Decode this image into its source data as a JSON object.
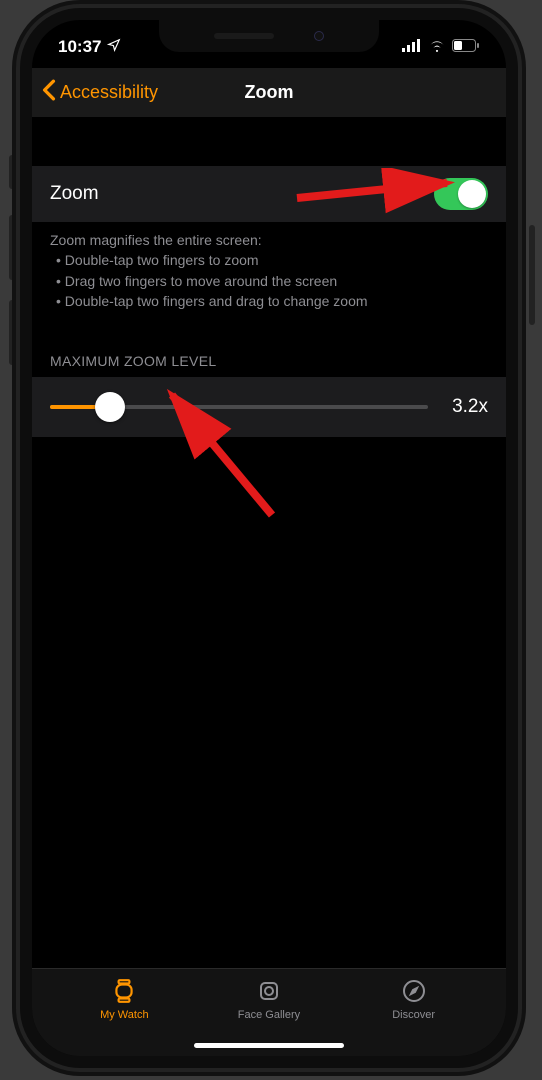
{
  "status": {
    "time": "10:37"
  },
  "nav": {
    "back_label": "Accessibility",
    "title": "Zoom"
  },
  "zoom_row": {
    "label": "Zoom",
    "enabled": true
  },
  "description": {
    "intro": "Zoom magnifies the entire screen:",
    "bullets": [
      "Double-tap two fingers to zoom",
      "Drag two fingers to move around the screen",
      "Double-tap two fingers and drag to change zoom"
    ]
  },
  "max_zoom": {
    "header": "MAXIMUM ZOOM LEVEL",
    "value_label": "3.2x",
    "percent": 16
  },
  "tabs": {
    "my_watch": "My Watch",
    "face_gallery": "Face Gallery",
    "discover": "Discover"
  }
}
